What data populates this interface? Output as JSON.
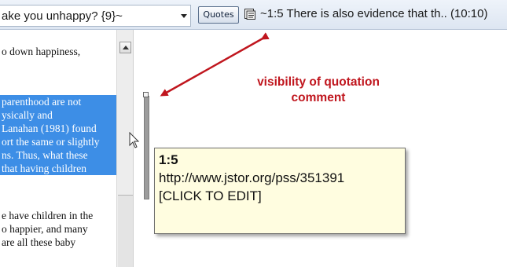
{
  "toolbar": {
    "code_combo_text": "ake you unhappy? {9}~",
    "quotes_button_label": "Quotes",
    "quote_icon": "quote-list-icon",
    "quote_combo_text": "~1:5 There is also evidence that th.. (10:10)"
  },
  "document": {
    "lines": [
      {
        "text": "o down happiness,",
        "selected": false
      },
      {
        "text": "parenthood are not",
        "selected": true
      },
      {
        "text": "ysically and",
        "selected": true
      },
      {
        "text": "Lanahan (1981) found",
        "selected": true
      },
      {
        "text": "ort the same or slightly",
        "selected": true
      },
      {
        "text": "ns. Thus, what these",
        "selected": true
      },
      {
        "text": "that having children",
        "selected": true
      },
      {
        "text": "e have children in the",
        "selected": false
      },
      {
        "text": "o happier, and many",
        "selected": false
      },
      {
        "text": "are all these baby",
        "selected": false
      }
    ]
  },
  "annotation": {
    "callout_line1": "visibility of quotation",
    "callout_line2": "comment",
    "arrow_color": "#c0161e"
  },
  "tooltip": {
    "id": "1:5",
    "url": "http://www.jstor.org/pss/351391",
    "edit_hint": "[CLICK TO EDIT]"
  },
  "colors": {
    "selection": "#3d8ee6",
    "tooltip_bg": "#fffde0",
    "callout": "#c0161e"
  }
}
